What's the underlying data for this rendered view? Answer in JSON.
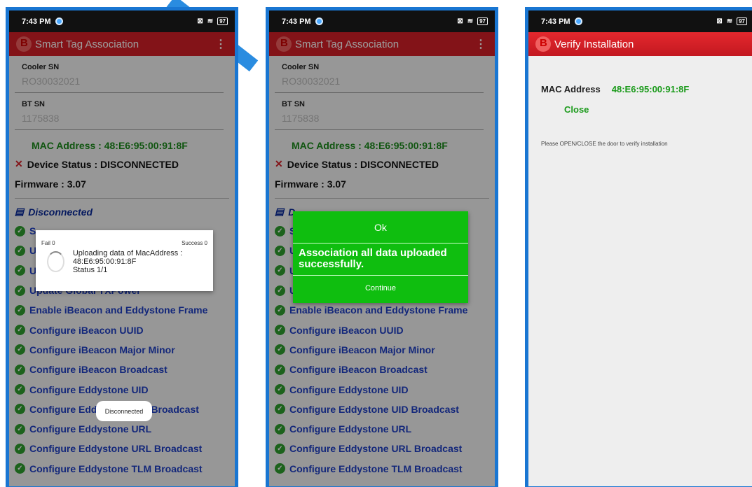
{
  "status": {
    "time": "7:43 PM",
    "battery": "97"
  },
  "screen1": {
    "title": "Smart Tag Association",
    "cooler_label": "Cooler SN",
    "cooler_value": "RO30032021",
    "bt_label": "BT SN",
    "bt_value": "1175838",
    "mac": "MAC Address : 48:E6:95:00:91:8F",
    "device_status": "Device Status : DISCONNECTED",
    "firmware": "Firmware : 3.07",
    "disconnected": "Disconnected",
    "steps": [
      "S",
      "U",
      "U",
      "Update Global TXPower",
      "Enable iBeacon and Eddystone Frame",
      "Configure iBeacon UUID",
      "Configure iBeacon Major Minor",
      "Configure iBeacon Broadcast",
      "Configure Eddystone UID",
      "Configure Eddystone UID Broadcast",
      "Configure Eddystone URL",
      "Configure Eddystone URL Broadcast",
      "Configure Eddystone TLM Broadcast"
    ],
    "dialog": {
      "fail": "Fail 0",
      "success": "Success 0",
      "message": "Uploading data of MacAddress : 48:E6:95:00:91:8F",
      "status": "Status 1/1"
    },
    "toast": "Disconnected"
  },
  "screen2": {
    "title": "Smart Tag Association",
    "cooler_label": "Cooler SN",
    "cooler_value": "RO30032021",
    "bt_label": "BT SN",
    "bt_value": "1175838",
    "mac": "MAC Address : 48:E6:95:00:91:8F",
    "device_status": "Device Status : DISCONNECTED",
    "firmware": "Firmware : 3.07",
    "disconnected": "D",
    "steps": [
      "S",
      "U",
      "U",
      "U",
      "Enable iBeacon and Eddystone Frame",
      "Configure iBeacon UUID",
      "Configure iBeacon Major Minor",
      "Configure iBeacon Broadcast",
      "Configure Eddystone UID",
      "Configure Eddystone UID Broadcast",
      "Configure Eddystone URL",
      "Configure Eddystone URL Broadcast",
      "Configure Eddystone TLM Broadcast"
    ],
    "dialog": {
      "ok": "Ok",
      "message": "Association all data uploaded successfully.",
      "continue": "Continue"
    }
  },
  "screen3": {
    "title": "Verify Installation",
    "mac_label": "MAC Address",
    "mac_value": "48:E6:95:00:91:8F",
    "close": "Close",
    "hint": "Please OPEN/CLOSE the door to verify installation"
  },
  "colors": {
    "appbar": "#d32027",
    "frame": "#1976d2",
    "success_green": "#0fbe0f",
    "step_blue": "#1f3fc6"
  }
}
